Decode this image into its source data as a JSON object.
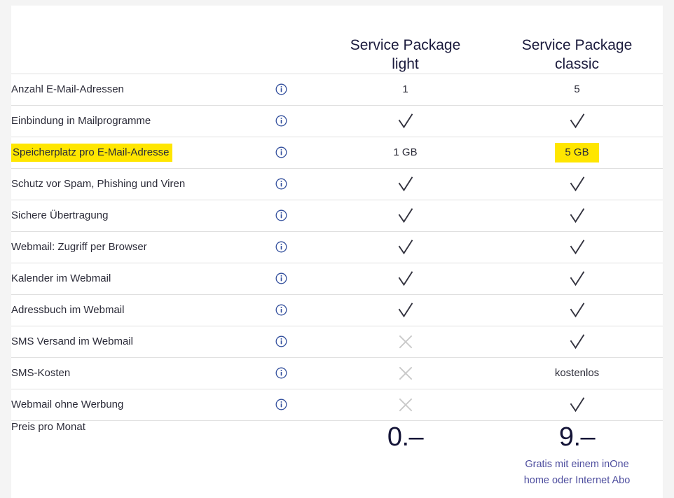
{
  "page": {
    "background_color": "#f4f4f4",
    "card_background": "#ffffff",
    "divider_color": "#e0e0e0",
    "highlight_color": "#ffe600",
    "heading_color": "#1a1a3c",
    "note_color": "#4d4d9e",
    "info_icon_color": "#2f4c9b",
    "cross_color": "#c9c9c9"
  },
  "header": {
    "label_column": "",
    "info_column": "",
    "packages": [
      {
        "name_line1": "Service Package",
        "name_line2": "light"
      },
      {
        "name_line1": "Service Package",
        "name_line2": "classic"
      }
    ]
  },
  "icons": {
    "info": "info-icon",
    "check": "check-icon",
    "cross": "cross-icon"
  },
  "rows": [
    {
      "label": "Anzahl E-Mail-Adressen",
      "label_highlighted": false,
      "info": "info-icon",
      "light": {
        "type": "text",
        "value": "1",
        "highlighted": false
      },
      "classic": {
        "type": "text",
        "value": "5",
        "highlighted": false
      }
    },
    {
      "label": "Einbindung in Mailprogramme",
      "label_highlighted": false,
      "info": "info-icon",
      "light": {
        "type": "check",
        "value": "",
        "highlighted": false
      },
      "classic": {
        "type": "check",
        "value": "",
        "highlighted": false
      }
    },
    {
      "label": "Speicherplatz pro E-Mail-Adresse",
      "label_highlighted": true,
      "info": "info-icon",
      "light": {
        "type": "text",
        "value": "1 GB",
        "highlighted": false
      },
      "classic": {
        "type": "text",
        "value": "5 GB",
        "highlighted": true
      }
    },
    {
      "label": "Schutz vor Spam, Phishing und Viren",
      "label_highlighted": false,
      "info": "info-icon",
      "light": {
        "type": "check",
        "value": "",
        "highlighted": false
      },
      "classic": {
        "type": "check",
        "value": "",
        "highlighted": false
      }
    },
    {
      "label": "Sichere Übertragung",
      "label_highlighted": false,
      "info": "info-icon",
      "light": {
        "type": "check",
        "value": "",
        "highlighted": false
      },
      "classic": {
        "type": "check",
        "value": "",
        "highlighted": false
      }
    },
    {
      "label": "Webmail: Zugriff per Browser",
      "label_highlighted": false,
      "info": "info-icon",
      "light": {
        "type": "check",
        "value": "",
        "highlighted": false
      },
      "classic": {
        "type": "check",
        "value": "",
        "highlighted": false
      }
    },
    {
      "label": "Kalender im Webmail",
      "label_highlighted": false,
      "info": "info-icon",
      "light": {
        "type": "check",
        "value": "",
        "highlighted": false
      },
      "classic": {
        "type": "check",
        "value": "",
        "highlighted": false
      }
    },
    {
      "label": "Adressbuch im Webmail",
      "label_highlighted": false,
      "info": "info-icon",
      "light": {
        "type": "check",
        "value": "",
        "highlighted": false
      },
      "classic": {
        "type": "check",
        "value": "",
        "highlighted": false
      }
    },
    {
      "label": "SMS Versand im Webmail",
      "label_highlighted": false,
      "info": "info-icon",
      "light": {
        "type": "cross",
        "value": "",
        "highlighted": false
      },
      "classic": {
        "type": "check",
        "value": "",
        "highlighted": false
      }
    },
    {
      "label": "SMS-Kosten",
      "label_highlighted": false,
      "info": "info-icon",
      "light": {
        "type": "cross",
        "value": "",
        "highlighted": false
      },
      "classic": {
        "type": "text",
        "value": "kostenlos",
        "highlighted": false
      }
    },
    {
      "label": "Webmail ohne Werbung",
      "label_highlighted": false,
      "info": "info-icon",
      "light": {
        "type": "cross",
        "value": "",
        "highlighted": false
      },
      "classic": {
        "type": "check",
        "value": "",
        "highlighted": false
      }
    }
  ],
  "price": {
    "label": "Preis pro Monat",
    "light": "0.–",
    "classic": "9.–"
  },
  "note": {
    "light": "",
    "classic_line1": "Gratis mit einem inOne",
    "classic_line2": "home oder Internet Abo"
  }
}
